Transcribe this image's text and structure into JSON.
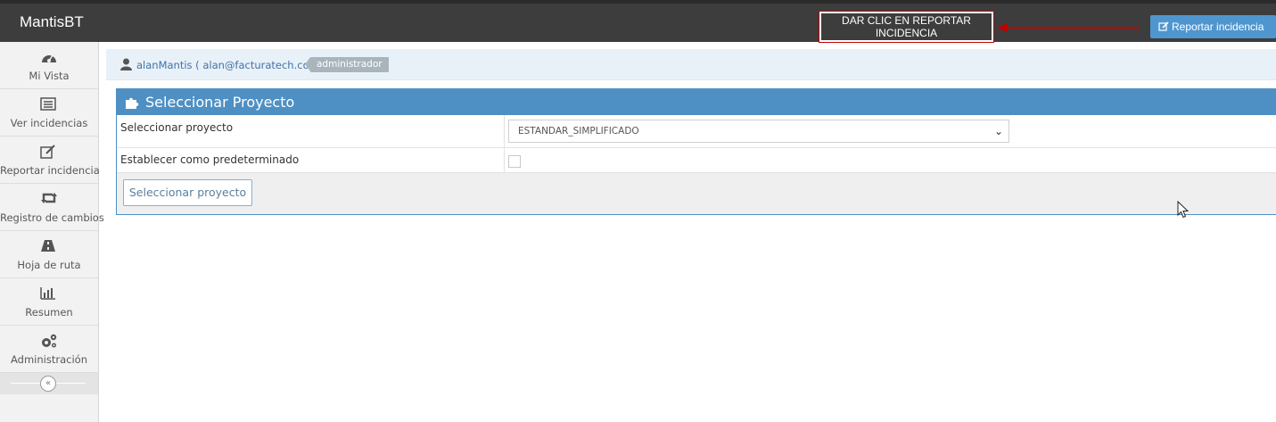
{
  "navbar": {
    "brand": "MantisBT",
    "annotation": "DAR CLIC EN REPORTAR INCIDENCIA",
    "report_button": "Reportar incidencia"
  },
  "sidebar": {
    "items": [
      {
        "label": "Mi Vista",
        "icon": "dashboard-icon"
      },
      {
        "label": "Ver incidencias",
        "icon": "list-icon"
      },
      {
        "label": "Reportar incidencia",
        "icon": "edit-icon"
      },
      {
        "label": "Registro de cambios",
        "icon": "retweet-icon"
      },
      {
        "label": "Hoja de ruta",
        "icon": "road-icon"
      },
      {
        "label": "Resumen",
        "icon": "bar-chart-icon"
      },
      {
        "label": "Administración",
        "icon": "gears-icon"
      }
    ]
  },
  "user": {
    "text": "alanMantis ( alan@facturatech.co )",
    "role": "administrador"
  },
  "form": {
    "title": "Seleccionar Proyecto",
    "project_label": "Seleccionar proyecto",
    "project_value": "ESTANDAR_SIMPLIFICADO",
    "default_label": "Establecer como predeterminado",
    "submit": "Seleccionar proyecto"
  },
  "colors": {
    "navbar": "#3d3d3d",
    "accent": "#4f90c4",
    "annotation_red": "#c00000"
  }
}
